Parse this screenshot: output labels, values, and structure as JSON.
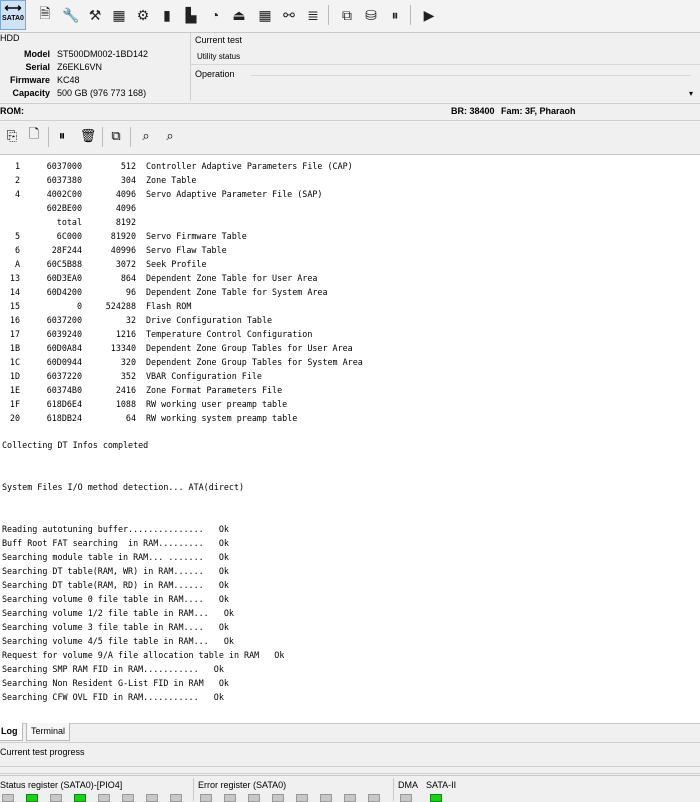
{
  "toolbar": {
    "sata_label": "SATA0",
    "icons": [
      "sata-port-icon",
      "document-icon",
      "wrench-icon",
      "tools-icon",
      "chip-icon",
      "gear-icon",
      "memory-icon",
      "drive-icon",
      "disk-icon",
      "upload-icon",
      "grid-icon",
      "network-icon",
      "list-icon",
      "copy-icon",
      "database-icon",
      "recorder-icon",
      "play-icon"
    ]
  },
  "hdd": {
    "header": "HDD",
    "model_label": "Model",
    "model": "ST500DM002-1BD142",
    "serial_label": "Serial",
    "serial": "Z6EKL6VN",
    "firmware_label": "Firmware",
    "firmware": "KC48",
    "capacity_label": "Capacity",
    "capacity": "500 GB (976 773 168)"
  },
  "test": {
    "current_test_label": "Current test",
    "utility_status": "Utility status",
    "operation_label": "Operation"
  },
  "status": {
    "rom_label": "ROM:",
    "br": "BR: 38400",
    "fam": "Fam: 3F, Pharaoh"
  },
  "log": {
    "table": [
      {
        "id": "1",
        "addr": "6037000",
        "size": "512",
        "desc": "Controller Adaptive Parameters File (CAP)"
      },
      {
        "id": "2",
        "addr": "6037380",
        "size": "304",
        "desc": "Zone Table"
      },
      {
        "id": "4",
        "addr": "4002C00",
        "size": "4096",
        "desc": "Servo Adaptive Parameter File (SAP)"
      },
      {
        "id": "",
        "addr": "602BE00",
        "size": "4096",
        "desc": ""
      },
      {
        "id": "",
        "addr": "total",
        "size": "8192",
        "desc": ""
      },
      {
        "id": "5",
        "addr": "6C000",
        "size": "81920",
        "desc": "Servo Firmware Table"
      },
      {
        "id": "6",
        "addr": "28F244",
        "size": "40996",
        "desc": "Servo Flaw Table"
      },
      {
        "id": "A",
        "addr": "60C5B88",
        "size": "3072",
        "desc": "Seek Profile"
      },
      {
        "id": "13",
        "addr": "60D3EA0",
        "size": "864",
        "desc": "Dependent Zone Table for User Area"
      },
      {
        "id": "14",
        "addr": "60D4200",
        "size": "96",
        "desc": "Dependent Zone Table for System Area"
      },
      {
        "id": "15",
        "addr": "0",
        "size": "524288",
        "desc": "Flash ROM"
      },
      {
        "id": "16",
        "addr": "6037200",
        "size": "32",
        "desc": "Drive Configuration Table"
      },
      {
        "id": "17",
        "addr": "6039240",
        "size": "1216",
        "desc": "Temperature Control Configuration"
      },
      {
        "id": "1B",
        "addr": "60D0A84",
        "size": "13340",
        "desc": "Dependent Zone Group Tables for User Area"
      },
      {
        "id": "1C",
        "addr": "60D0944",
        "size": "320",
        "desc": "Dependent Zone Group Tables for System Area"
      },
      {
        "id": "1D",
        "addr": "6037220",
        "size": "352",
        "desc": "VBAR Configuration File"
      },
      {
        "id": "1E",
        "addr": "60374B0",
        "size": "2416",
        "desc": "Zone Format Parameters File"
      },
      {
        "id": "1F",
        "addr": "618D6E4",
        "size": "1088",
        "desc": "RW working user preamp table"
      },
      {
        "id": "20",
        "addr": "618DB24",
        "size": "64",
        "desc": "RW working system preamp table"
      }
    ],
    "collecting": "Collecting DT Infos completed",
    "io_method": "System Files I/O method detection... ATA(direct)",
    "lines": [
      "Reading autotuning buffer...............   Ok",
      "Buff Root FAT searching  in RAM.........   Ok",
      "Searching module table in RAM... .......   Ok",
      "Searching DT table(RAM, WR) in RAM......   Ok",
      "Searching DT table(RAM, RD) in RAM......   Ok",
      "Searching volume 0 file table in RAM....   Ok",
      "Searching volume 1/2 file table in RAM...   Ok",
      "Searching volume 3 file table in RAM....   Ok",
      "Searching volume 4/5 file table in RAM...   Ok",
      "Request for volume 9/A file allocation table in RAM   Ok",
      "Searching SMP RAM FID in RAM...........   Ok",
      "Searching Non Resident G-List FID in RAM   Ok",
      "Searching CFW OVL FID in RAM...........   Ok"
    ]
  },
  "tabs": {
    "log": "Log",
    "terminal": "Terminal"
  },
  "progress_label": "Current test progress",
  "registers": {
    "status_label": "Status register (SATA0)-[PIO4]",
    "error_label": "Error register (SATA0)",
    "dma_label": "DMA",
    "sata_label": "SATA-II",
    "status_leds": [
      false,
      true,
      false,
      true,
      false,
      false,
      false,
      false
    ],
    "error_leds": [
      false,
      false,
      false,
      false,
      false,
      false,
      false,
      false
    ],
    "dma_led": false,
    "sata_led": true,
    "led_on_color": "#19d219"
  }
}
